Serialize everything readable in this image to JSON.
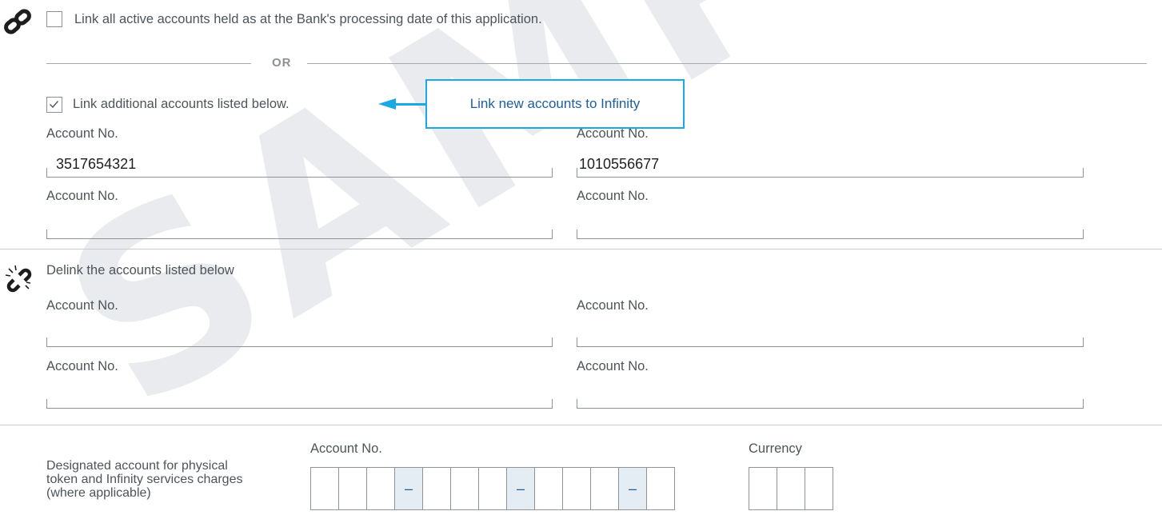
{
  "watermark": "SAMPLE",
  "link_all": {
    "label": "Link all active accounts held as at the Bank's processing date of this application.",
    "checked": false,
    "icon": "link-icon"
  },
  "or_separator": "OR",
  "link_additional": {
    "label": "Link additional accounts listed below.",
    "checked": true,
    "fields": [
      {
        "label": "Account No.",
        "value": "3517654321"
      },
      {
        "label": "Account No.",
        "value": "1010556677"
      },
      {
        "label": "Account No.",
        "value": ""
      },
      {
        "label": "Account No.",
        "value": ""
      }
    ]
  },
  "callout": {
    "text": "Link new accounts to Infinity",
    "accent": "#1aa9e4"
  },
  "delink": {
    "label": "Delink the accounts listed below",
    "icon": "broken-link-icon",
    "fields": [
      {
        "label": "Account No.",
        "value": ""
      },
      {
        "label": "Account No.",
        "value": ""
      },
      {
        "label": "Account No.",
        "value": ""
      },
      {
        "label": "Account No.",
        "value": ""
      }
    ]
  },
  "designated": {
    "description": "Designated account for physical token and Infinity services charges (where applicable)",
    "account_label": "Account No.",
    "account_separator": "–",
    "currency_label": "Currency"
  }
}
